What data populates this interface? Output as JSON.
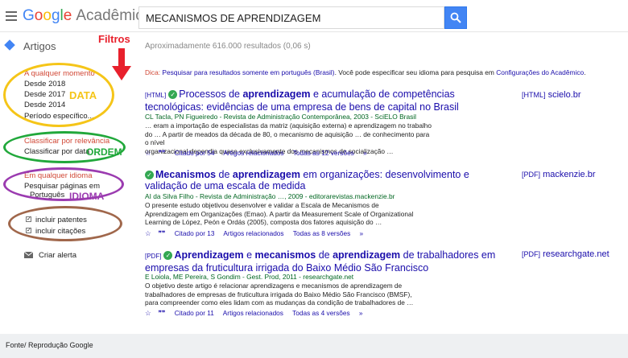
{
  "header": {
    "logo_google": "Google",
    "logo_rest": "Acadêmico",
    "search_value": "MECANISMOS DE APRENDIZAGEM"
  },
  "subbar": {
    "artigos": "Artigos",
    "filtros": "Filtros",
    "results_count": "Aproximadamente 616.000 resultados (0,06 s)"
  },
  "sidebar": {
    "time_heading": "A qualquer momento",
    "time_items": [
      "Desde 2018",
      "Desde 2017",
      "Desde 2014",
      "Período específico..."
    ],
    "sort_relevance": "Classificar por relevância",
    "sort_date": "Classificar por data",
    "lang_heading": "Em qualquer idioma",
    "lang_pt_1": "Pesquisar páginas em",
    "lang_pt_2": "Português",
    "include_patents": "incluir patentes",
    "include_citations": "incluir citações",
    "create_alert": "Criar alerta"
  },
  "annotations": {
    "data": "DATA",
    "ordem": "ORDEM",
    "idioma": "IDIOMA"
  },
  "dica": {
    "prefix": "Dica:",
    "text1": "Pesquisar para resultados somente em",
    "lang": "português (Brasil)",
    "text2": ". Você pode especificar seu idioma para pesquisa em",
    "link": "Configurações do Acadêmico",
    "suffix": "."
  },
  "results": [
    {
      "tag": "[HTML]",
      "title_parts": [
        "Processos de ",
        "aprendizagem",
        " e acumulação de competências"
      ],
      "title_line2": "tecnológicas: evidências de uma empresa de bens de capital no Brasil",
      "meta": "CL Tacla, PN Figueiredo - Revista de Administração Contemporânea, 2003 - SciELO Brasil",
      "snippet": [
        "… eram a importação de especialistas da matriz (aquisição externa) e aprendizagem no trabalho",
        "do … A partir de meados da década de 80, o mecanismo de aquisição … de conhecimento para o nível",
        "organizacional dependia quase exclusivamente dos mecanismos de socialização …"
      ],
      "cited": "Citado por 54",
      "related": "Artigos relacionados",
      "versions": "Todas as 12 versões",
      "right_tag": "[HTML]",
      "right_domain": "scielo.br"
    },
    {
      "tag": "",
      "title_parts": [
        "Mecanismos",
        " de ",
        "aprendizagem",
        " em organizações: desenvolvimento e"
      ],
      "title_line2": "validação de uma escala de medida",
      "meta": "AI da Silva Filho - Revista de Administração …, 2009 - editorarevistas.mackenzie.br",
      "snippet": [
        "O presente estudo objetivou desenvolver e validar a Escala de Mecanismos de",
        "Aprendizagem em Organizações (Emao). A partir da Measurement Scale of Organizational",
        "Learning de López, Peón e Ordás (2005), composta dos fatores aquisição do …"
      ],
      "cited": "Citado por 13",
      "related": "Artigos relacionados",
      "versions": "Todas as 8 versões",
      "right_tag": "[PDF]",
      "right_domain": "mackenzie.br"
    },
    {
      "tag": "[PDF]",
      "title_parts": [
        "Aprendizagem",
        " e ",
        "mecanismos",
        " de ",
        "aprendizagem",
        " de trabalhadores em"
      ],
      "title_line2": "empresas da fruticultura irrigada do Baixo Médio São Francisco",
      "meta": "E Loiola, ME Pereira, S Gondim - Gest. Prod, 2011 - researchgate.net",
      "snippet": [
        "O objetivo deste artigo é relacionar aprendizagens e mecanismos de aprendizagem de",
        "trabalhadores de empresas de fruticultura irrigada do Baixo Médio São Francisco (BMSF),",
        "para compreender como eles lidam com as mudanças da condição de trabalhadores de …"
      ],
      "cited": "Citado por 11",
      "related": "Artigos relacionados",
      "versions": "Todas as 4 versões",
      "right_tag": "[PDF]",
      "right_domain": "researchgate.net"
    }
  ],
  "footer": "Fonte/ Reprodução Google",
  "colors": {
    "link": "#1a0dab",
    "green": "#006621",
    "filter_red": "#d14836",
    "annot_yellow": "#f5c518",
    "annot_green": "#21a83b",
    "annot_purple": "#9b3bb0",
    "annot_brown": "#a0674b"
  }
}
